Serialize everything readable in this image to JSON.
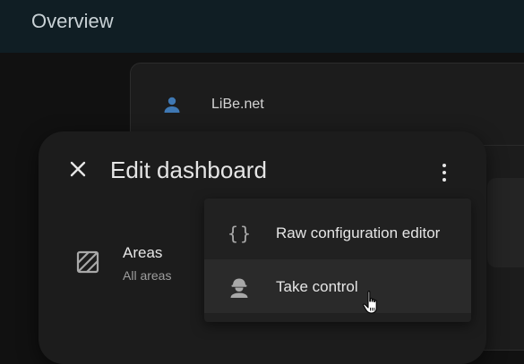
{
  "header": {
    "title": "Overview"
  },
  "background_card": {
    "entity_name": "LiBe.net",
    "icon": "account-icon",
    "icon_color": "#3f78b3"
  },
  "dialog": {
    "title": "Edit dashboard",
    "close_icon": "close-icon",
    "more_icon": "dots-vertical-icon",
    "strategy": {
      "label": "Areas",
      "sublabel": "All areas",
      "icon": "texture-box-icon"
    }
  },
  "menu": {
    "items": [
      {
        "label": "Raw configuration editor",
        "icon": "code-braces-icon"
      },
      {
        "label": "Take control",
        "icon": "account-hard-hat-icon"
      }
    ]
  },
  "colors": {
    "background": "#111111",
    "surface": "#1c1c1c",
    "menu": "#212121",
    "topbar": "#101e24"
  }
}
